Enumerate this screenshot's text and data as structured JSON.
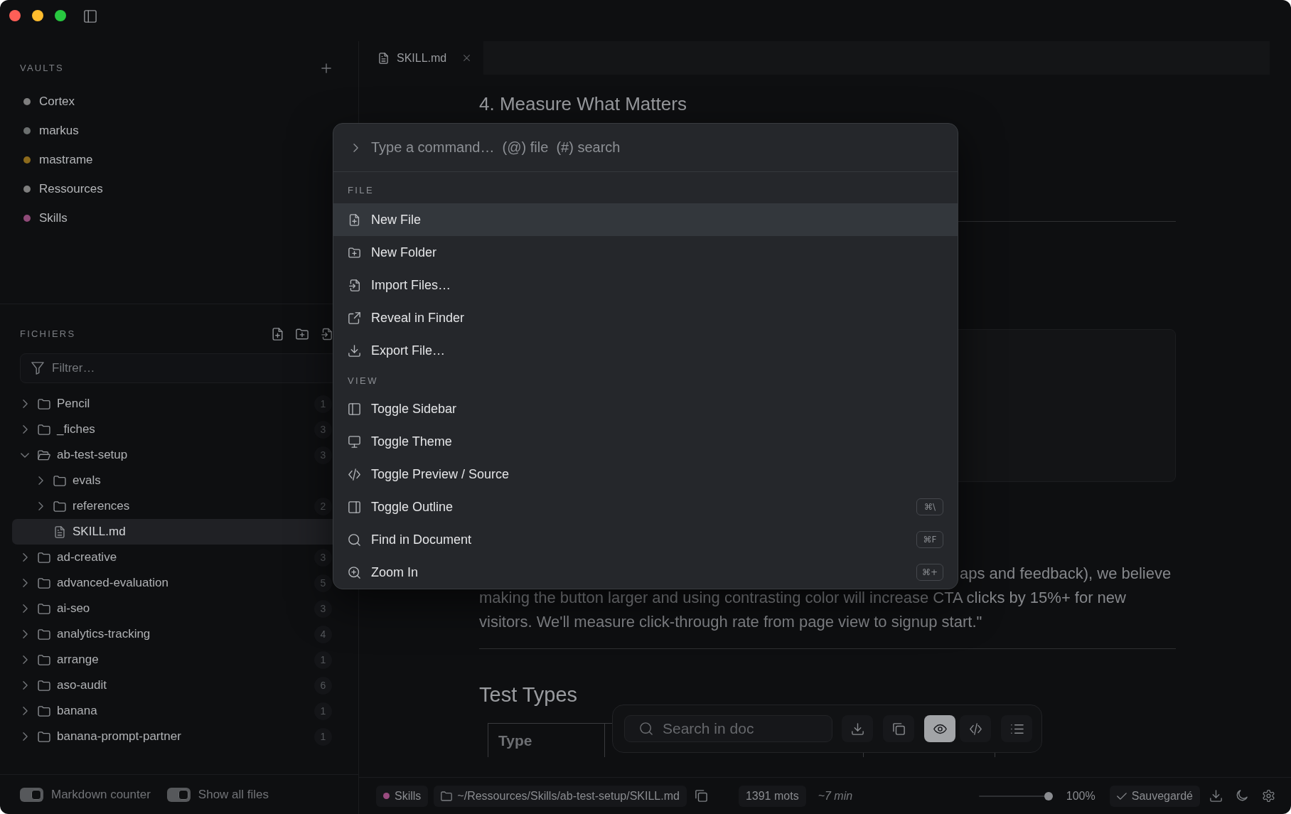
{
  "sidebar": {
    "vaults": {
      "title": "VAULTS",
      "items": [
        {
          "name": "Cortex",
          "color": "#7e7e7e"
        },
        {
          "name": "markus",
          "color": "#6b6f6f"
        },
        {
          "name": "mastrame",
          "color": "#8c6a1c"
        },
        {
          "name": "Ressources",
          "color": "#7e7e7e"
        },
        {
          "name": "Skills",
          "color": "#8f4a78"
        }
      ]
    },
    "files": {
      "title": "FICHIERS",
      "filter": {
        "placeholder": "Filtrer…"
      },
      "tree": [
        {
          "name": "Pencil",
          "kind": "folder",
          "count": "1",
          "expanded": false,
          "selected": false
        },
        {
          "name": "_fiches",
          "kind": "folder",
          "count": "3",
          "expanded": false,
          "selected": false
        },
        {
          "name": "ab-test-setup",
          "kind": "folder",
          "count": "3",
          "expanded": true,
          "selected": false,
          "children": [
            {
              "name": "evals",
              "kind": "folder",
              "expanded": false,
              "selected": false
            },
            {
              "name": "references",
              "kind": "folder",
              "count": "2",
              "expanded": false,
              "selected": false
            },
            {
              "name": "SKILL.md",
              "kind": "file",
              "selected": true
            }
          ]
        },
        {
          "name": "ad-creative",
          "kind": "folder",
          "count": "3",
          "expanded": false,
          "selected": false
        },
        {
          "name": "advanced-evaluation",
          "kind": "folder",
          "count": "5",
          "expanded": false,
          "selected": false
        },
        {
          "name": "ai-seo",
          "kind": "folder",
          "count": "3",
          "expanded": false,
          "selected": false
        },
        {
          "name": "analytics-tracking",
          "kind": "folder",
          "count": "4",
          "expanded": false,
          "selected": false
        },
        {
          "name": "arrange",
          "kind": "folder",
          "count": "1",
          "expanded": false,
          "selected": false
        },
        {
          "name": "aso-audit",
          "kind": "folder",
          "count": "6",
          "expanded": false,
          "selected": false
        },
        {
          "name": "banana",
          "kind": "folder",
          "count": "1",
          "expanded": false,
          "selected": false
        },
        {
          "name": "banana-prompt-partner",
          "kind": "folder",
          "count": "1",
          "expanded": false,
          "selected": false
        }
      ]
    },
    "footer": {
      "toggles": [
        {
          "label": "Markdown counter",
          "on": true
        },
        {
          "label": "Show all files",
          "on": true
        }
      ]
    }
  },
  "editor": {
    "tabs": [
      {
        "label": "SKILL.md",
        "selected": true
      }
    ],
    "blocks": [
      {
        "kind": "heading",
        "text": "4. Measure What Matters"
      },
      {
        "kind": "rule"
      },
      {
        "kind": "card"
      },
      {
        "kind": "fragment",
        "text": "aps and feedback), we believe"
      },
      {
        "kind": "paragraph",
        "text": "making the button larger and using contrasting color will increase CTA clicks by 15%+ for new visitors. We'll measure click-through rate from page view to signup start.\""
      },
      {
        "kind": "rule"
      },
      {
        "kind": "title",
        "text": "Test Types"
      },
      {
        "kind": "table",
        "columns": [
          {
            "label": "Type"
          }
        ]
      }
    ]
  },
  "floating_toolbar": {
    "search": {
      "placeholder": "Search in doc"
    },
    "actions": [
      {
        "kind": "download"
      },
      {
        "kind": "copy"
      }
    ],
    "view_modes": [
      {
        "kind": "preview",
        "selected": true
      },
      {
        "kind": "source",
        "selected": false
      }
    ],
    "panels": [
      {
        "kind": "outline"
      }
    ]
  },
  "status_bar": {
    "vault": {
      "name": "Skills",
      "color": "#9a4c80"
    },
    "path": "~/Ressources/Skills/ab-test-setup/SKILL.md",
    "word_count": "1391 mots",
    "reading_time": "~7 min",
    "zoom": {
      "level": 1,
      "reading": "100%"
    },
    "save_state": "Sauvegardé"
  },
  "command_palette": {
    "input": {
      "placeholder": "Type a command…  (@) file  (#) search"
    },
    "sections": [
      {
        "title": "FILE",
        "items": [
          {
            "kind": "newfile",
            "label": "New File",
            "selected": true
          },
          {
            "kind": "newfolder",
            "label": "New Folder",
            "selected": false
          },
          {
            "kind": "import",
            "label": "Import Files…",
            "selected": false
          },
          {
            "kind": "reveal",
            "label": "Reveal in Finder",
            "selected": false
          },
          {
            "kind": "export",
            "label": "Export File…",
            "selected": false
          }
        ]
      },
      {
        "title": "VIEW",
        "items": [
          {
            "kind": "sidebar",
            "label": "Toggle Sidebar",
            "selected": false
          },
          {
            "kind": "theme",
            "label": "Toggle Theme",
            "selected": false
          },
          {
            "kind": "source",
            "label": "Toggle Preview / Source",
            "selected": false
          },
          {
            "kind": "outline",
            "label": "Toggle Outline",
            "shortcut": "⌘\\",
            "selected": false
          },
          {
            "kind": "find",
            "label": "Find in Document",
            "shortcut": "⌘F",
            "selected": false
          },
          {
            "kind": "zoomin",
            "label": "Zoom In",
            "shortcut": "⌘+",
            "selected": false
          }
        ]
      }
    ]
  }
}
